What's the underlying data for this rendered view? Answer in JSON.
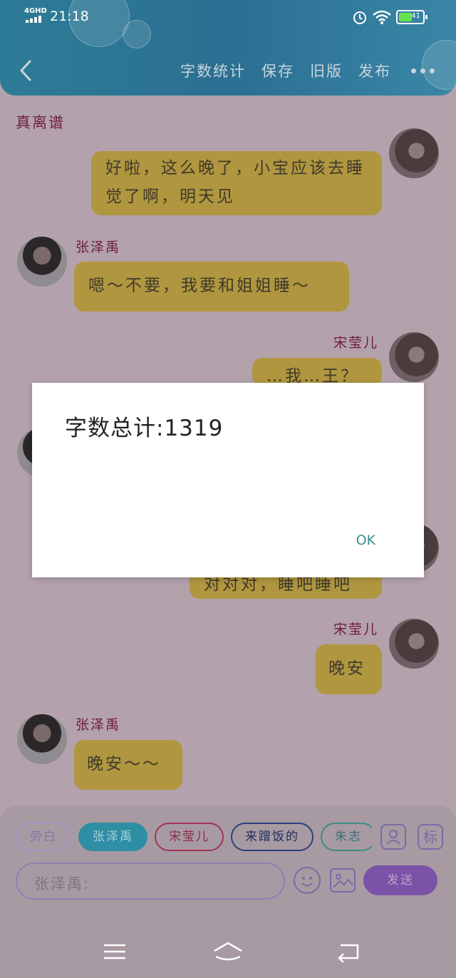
{
  "status": {
    "network": "4GHD",
    "time": "21:18",
    "battery": "41"
  },
  "header": {
    "actions": [
      "字数统计",
      "保存",
      "旧版",
      "发布"
    ]
  },
  "story_title": "真离谱",
  "messages": [
    {
      "sender": "",
      "side": "right",
      "text": "好啦，这么晚了，小宝应该去睡觉了啊，明天见"
    },
    {
      "sender": "张泽禹",
      "side": "left",
      "text": "嗯～不要，我要和姐姐睡～"
    },
    {
      "sender": "宋莹儿",
      "side": "right",
      "text": "…我…王？"
    },
    {
      "sender": "",
      "side": "right",
      "text": "对对对，睡吧睡吧"
    },
    {
      "sender": "宋莹儿",
      "side": "right",
      "text": "晚安"
    },
    {
      "sender": "张泽禹",
      "side": "left",
      "text": "晚安～～"
    }
  ],
  "dialog": {
    "content": "字数总计:1319",
    "ok_label": "OK"
  },
  "panel": {
    "chips": [
      "旁白",
      "张泽禹",
      "宋莹儿",
      "来蹭饭的",
      "朱志"
    ],
    "marker_label": "标",
    "input_value": "张泽禹:",
    "send_label": "发送"
  }
}
